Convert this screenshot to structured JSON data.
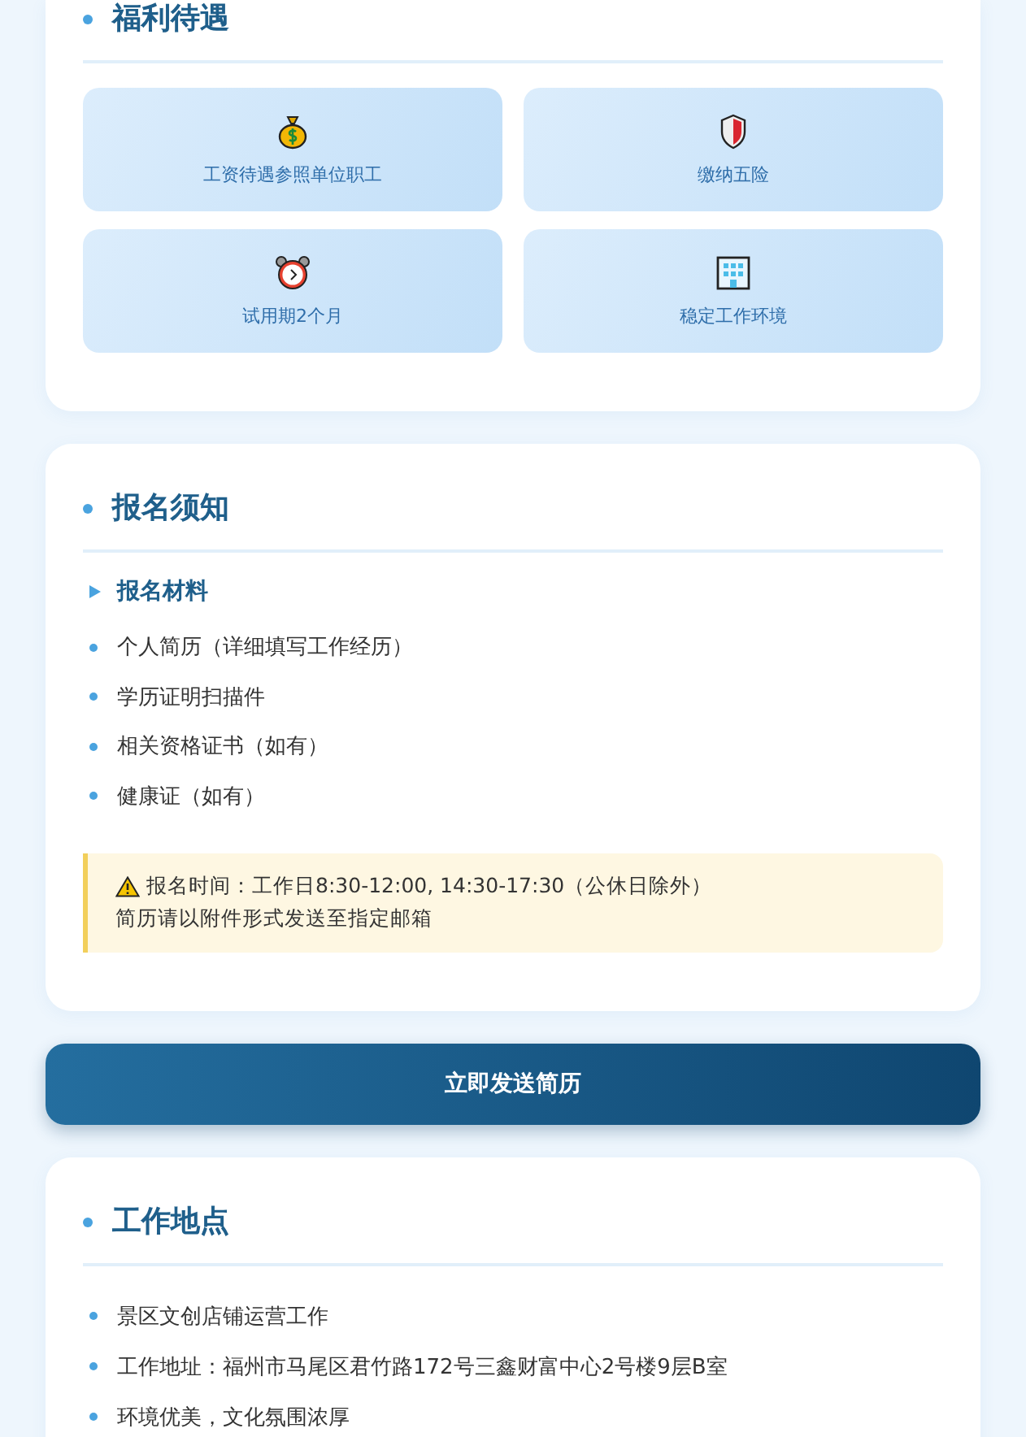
{
  "sections": [
    {
      "kind": "benefits",
      "title": "福利待遇",
      "tiles": [
        {
          "kind": "money",
          "label": "工资待遇参照单位职工"
        },
        {
          "kind": "shield",
          "label": "缴纳五险"
        },
        {
          "kind": "clock",
          "label": "试用期2个月"
        },
        {
          "kind": "building",
          "label": "稳定工作环境"
        }
      ]
    },
    {
      "kind": "notice",
      "title": "报名须知",
      "subtitle": "报名材料",
      "items": [
        "个人简历（详细填写工作经历）",
        "学历证明扫描件",
        "相关资格证书（如有）",
        "健康证（如有）"
      ],
      "tip": {
        "lines": [
          "报名时间：工作日8:30-12:00, 14:30-17:30（公休日除外）",
          "简历请以附件形式发送至指定邮箱"
        ]
      }
    },
    {
      "kind": "button",
      "label": "立即发送简历"
    },
    {
      "kind": "list",
      "title": "工作地点",
      "items": [
        "景区文创店铺运营工作",
        "工作地址：福州市马尾区君竹路172号三鑫财富中心2号楼9层B室",
        "环境优美，文化氛围浓厚"
      ]
    }
  ]
}
